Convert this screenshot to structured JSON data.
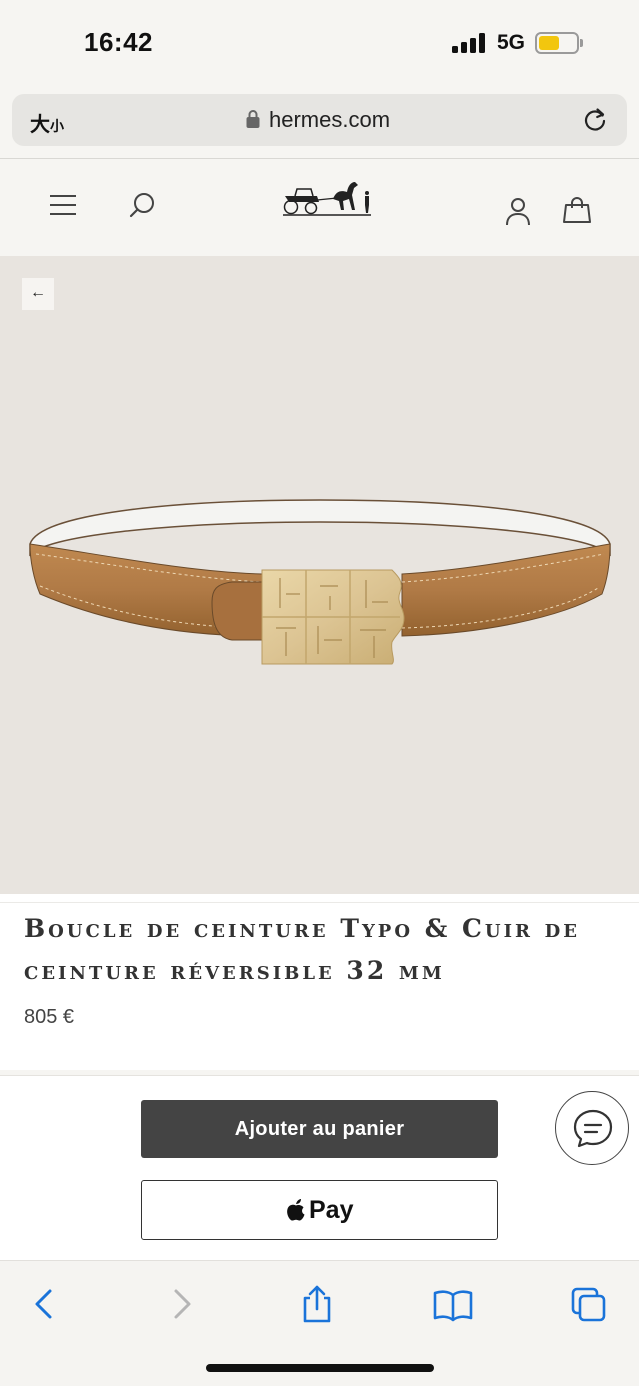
{
  "status_bar": {
    "time": "16:42",
    "network": "5G",
    "battery_level": 0.55,
    "battery_color": "#f2c60f"
  },
  "browser": {
    "text_size_label": "大",
    "text_size_label_small": "小",
    "url": "hermes.com",
    "lock_icon": "lock-icon",
    "reload_icon": "reload-icon"
  },
  "site_header": {
    "menu_icon": "hamburger-menu-icon",
    "search_icon": "search-icon",
    "logo": "hermes-carriage-logo",
    "account_icon": "account-icon",
    "bag_icon": "shopping-bag-icon"
  },
  "product": {
    "back_label": "←",
    "title": "Boucle de ceinture Typo & Cuir de ceinture réversible 32 mm",
    "price": "805 €",
    "image": "belt-product-image",
    "colors": {
      "leather": "#b07a46",
      "reverse_side": "#f4f4f2",
      "buckle": "#dcc493"
    }
  },
  "actions": {
    "add_to_cart_label": "Ajouter au panier",
    "apple_pay_label": "Pay",
    "chat_icon": "chat-icon"
  },
  "toolbar": {
    "back_icon": "chevron-left-icon",
    "forward_icon": "chevron-right-icon",
    "share_icon": "share-icon",
    "bookmarks_icon": "book-icon",
    "tabs_icon": "tabs-icon",
    "accent": "#1a73d9"
  }
}
